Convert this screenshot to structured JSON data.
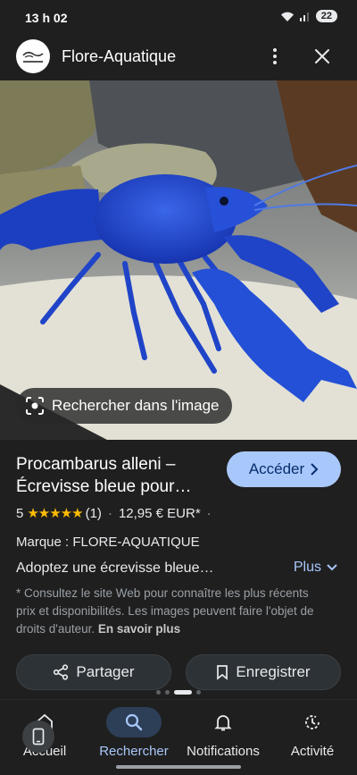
{
  "status_bar": {
    "time": "13 h 02",
    "battery": "22"
  },
  "header": {
    "site_name": "Flore-Aquatique",
    "logo_text": "FLORE-AQUATIQUE"
  },
  "image": {
    "lens_label": "Rechercher dans l'image"
  },
  "product": {
    "title_line1": "Procambarus alleni –",
    "title_line2": "Écrevisse bleue pour…",
    "visit_label": "Accéder",
    "rating": "5",
    "stars": "★★★★★",
    "review_count": "(1)",
    "separator": "·",
    "price": "12,95 € EUR*",
    "brand": "Marque : FLORE-AQUATIQUE",
    "description": "Adoptez une écrevisse bleue…",
    "more_label": "Plus",
    "disclaimer": "* Consultez le site Web pour connaître les plus récents prix et disponibilités. Les images peuvent faire l'objet de droits d'auteur.",
    "learn_more": "En savoir plus",
    "share_label": "Partager",
    "save_label": "Enregistrer"
  },
  "pager": {
    "count": 4,
    "active": 2
  },
  "bottom_nav": {
    "items": [
      {
        "label": "Accueil",
        "icon": "home-icon"
      },
      {
        "label": "Rechercher",
        "icon": "search-icon",
        "active": true
      },
      {
        "label": "Notifications",
        "icon": "bell-icon"
      },
      {
        "label": "Activité",
        "icon": "history-icon"
      }
    ]
  },
  "colors": {
    "accent": "#a8c7fa",
    "star": "#fbbc04",
    "crayfish": "#1f44c8",
    "background": "#1f1f1f"
  }
}
